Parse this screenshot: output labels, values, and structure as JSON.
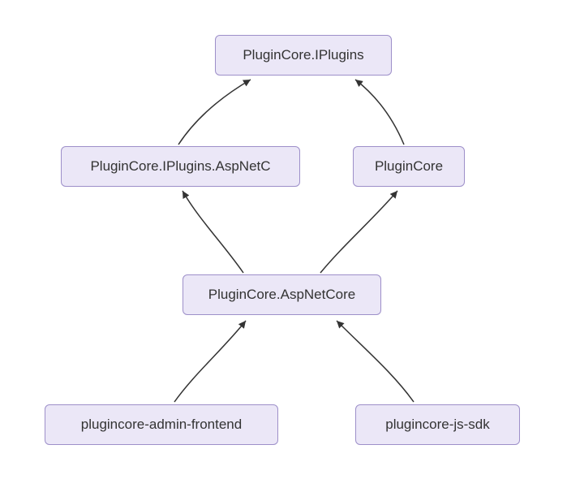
{
  "diagram": {
    "type": "dependency-graph",
    "nodes": {
      "iplugins": {
        "label": "PluginCore.IPlugins"
      },
      "iplugins_aspnet": {
        "label": "PluginCore.IPlugins.AspNetC"
      },
      "plugincore": {
        "label": "PluginCore"
      },
      "aspnetcore": {
        "label": "PluginCore.AspNetCore"
      },
      "admin_frontend": {
        "label": "plugincore-admin-frontend"
      },
      "js_sdk": {
        "label": "plugincore-js-sdk"
      }
    },
    "edges": [
      {
        "from": "iplugins_aspnet",
        "to": "iplugins"
      },
      {
        "from": "plugincore",
        "to": "iplugins"
      },
      {
        "from": "aspnetcore",
        "to": "iplugins_aspnet"
      },
      {
        "from": "aspnetcore",
        "to": "plugincore"
      },
      {
        "from": "admin_frontend",
        "to": "aspnetcore"
      },
      {
        "from": "js_sdk",
        "to": "aspnetcore"
      }
    ],
    "colors": {
      "node_fill": "#ebe7f7",
      "node_stroke": "#9d8fc9",
      "arrow": "#333333"
    }
  }
}
